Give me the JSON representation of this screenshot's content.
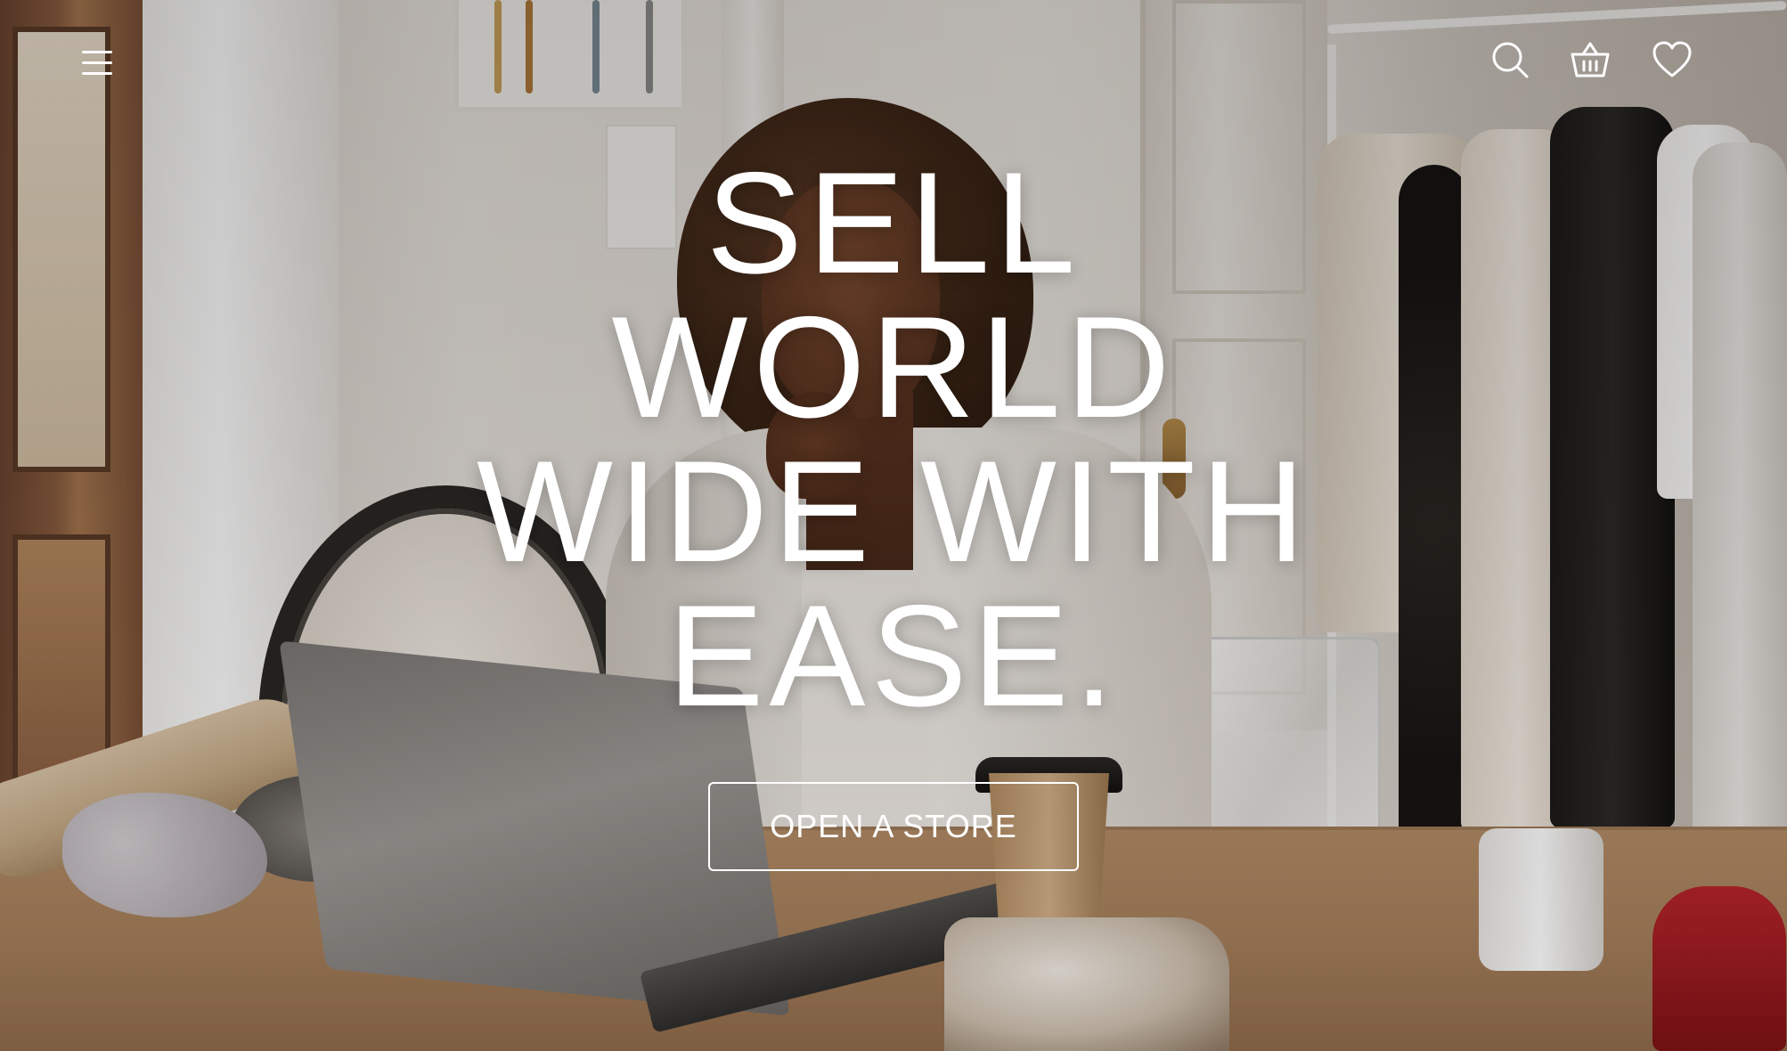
{
  "nav": {
    "menu_icon": "hamburger-menu-icon",
    "actions": [
      {
        "icon": "search-icon"
      },
      {
        "icon": "basket-icon"
      },
      {
        "icon": "heart-icon"
      }
    ]
  },
  "hero": {
    "headline_lines": [
      "SELL",
      "WORLD",
      "WIDE WITH",
      "EASE."
    ],
    "cta_label": "OPEN A STORE"
  },
  "colors": {
    "text": "#ffffff",
    "button_border": "#ffffff"
  }
}
